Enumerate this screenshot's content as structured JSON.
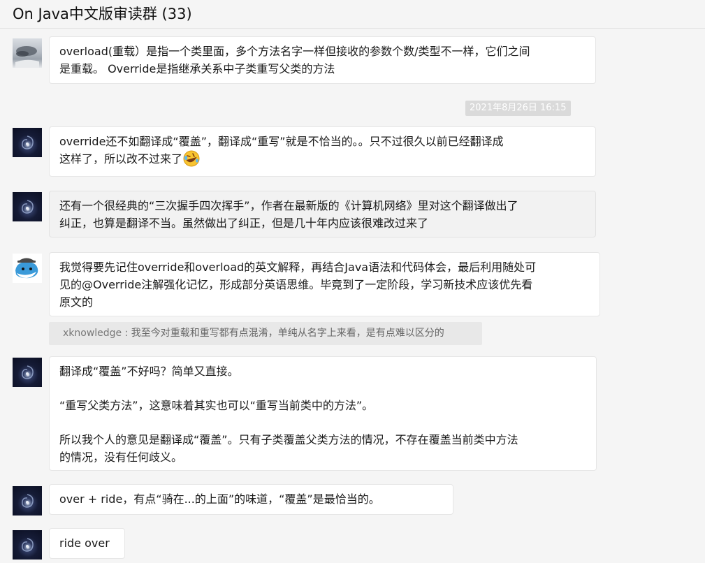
{
  "header": {
    "title": "On Java中文版审读群 (33)"
  },
  "timestamp": "2021年8月26日 16:15",
  "messages": [
    {
      "lines": [
        "overload(重载）是指一个类里面，多个方法名字一样但接收的参数个数/类型不一样，它们之间",
        "是重载。 Override是指继承关系中子类重写父类的方法"
      ]
    },
    {
      "lines": [
        "override还不如翻译成“覆盖”，翻译成“重写”就是不恰当的。。只不过很久以前已经翻译成",
        "这样了，所以改不过来了"
      ],
      "emoji": "rolling-on-floor-laughing-emoji"
    },
    {
      "lines": [
        "还有一个很经典的“三次握手四次挥手”，作者在最新版的《计算机网络》里对这个翻译做出了",
        "纠正，也算是翻译不当。虽然做出了纠正，但是几十年内应该很难改过来了"
      ]
    },
    {
      "lines": [
        "我觉得要先记住override和overload的英文解释，再结合Java语法和代码体会，最后利用随处可",
        "见的@Override注解强化记忆，形成部分英语思维。毕竟到了一定阶段，学习新技术应该优先看",
        "原文的"
      ]
    },
    {
      "lines": [
        "翻译成“覆盖”不好吗？简单又直接。",
        "“重写父类方法”，这意味着其实也可以“重写当前类中的方法”。",
        "所以我个人的意见是翻译成“覆盖”。只有子类覆盖父类方法的情况，不存在覆盖当前类中方法",
        "的情况，没有任何歧义。"
      ]
    },
    {
      "lines": [
        "over + ride，有点“骑在...的上面”的味道，“覆盖”是最恰当的。"
      ]
    },
    {
      "lines": [
        "ride over"
      ]
    }
  ],
  "quote": {
    "author": "xknowledge",
    "separator": " : ",
    "text": "我至今对重载和重写都有点混淆，单纯从名字上来看，是有点难以区分的"
  },
  "avatars": [
    "cloud-sky-avatar",
    "dark-space-avatar",
    "whale-avatar"
  ]
}
